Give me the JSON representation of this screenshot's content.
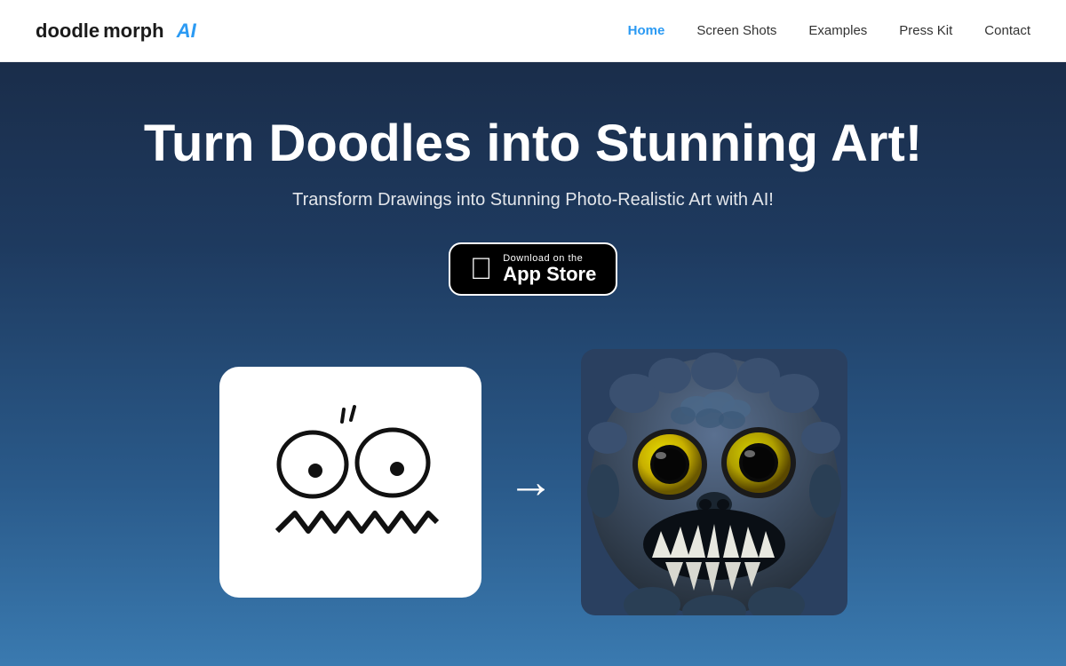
{
  "nav": {
    "logo": {
      "doodle": "doodle",
      "morph": "morph",
      "ai": "AI"
    },
    "links": [
      {
        "label": "Home",
        "active": true
      },
      {
        "label": "Screen Shots",
        "active": false
      },
      {
        "label": "Examples",
        "active": false
      },
      {
        "label": "Press Kit",
        "active": false
      },
      {
        "label": "Contact",
        "active": false
      }
    ]
  },
  "hero": {
    "title": "Turn Doodles into Stunning Art!",
    "subtitle": "Transform Drawings into Stunning Photo-Realistic Art with AI!",
    "appstore": {
      "small_text": "Download on the",
      "big_text": "App Store"
    }
  }
}
